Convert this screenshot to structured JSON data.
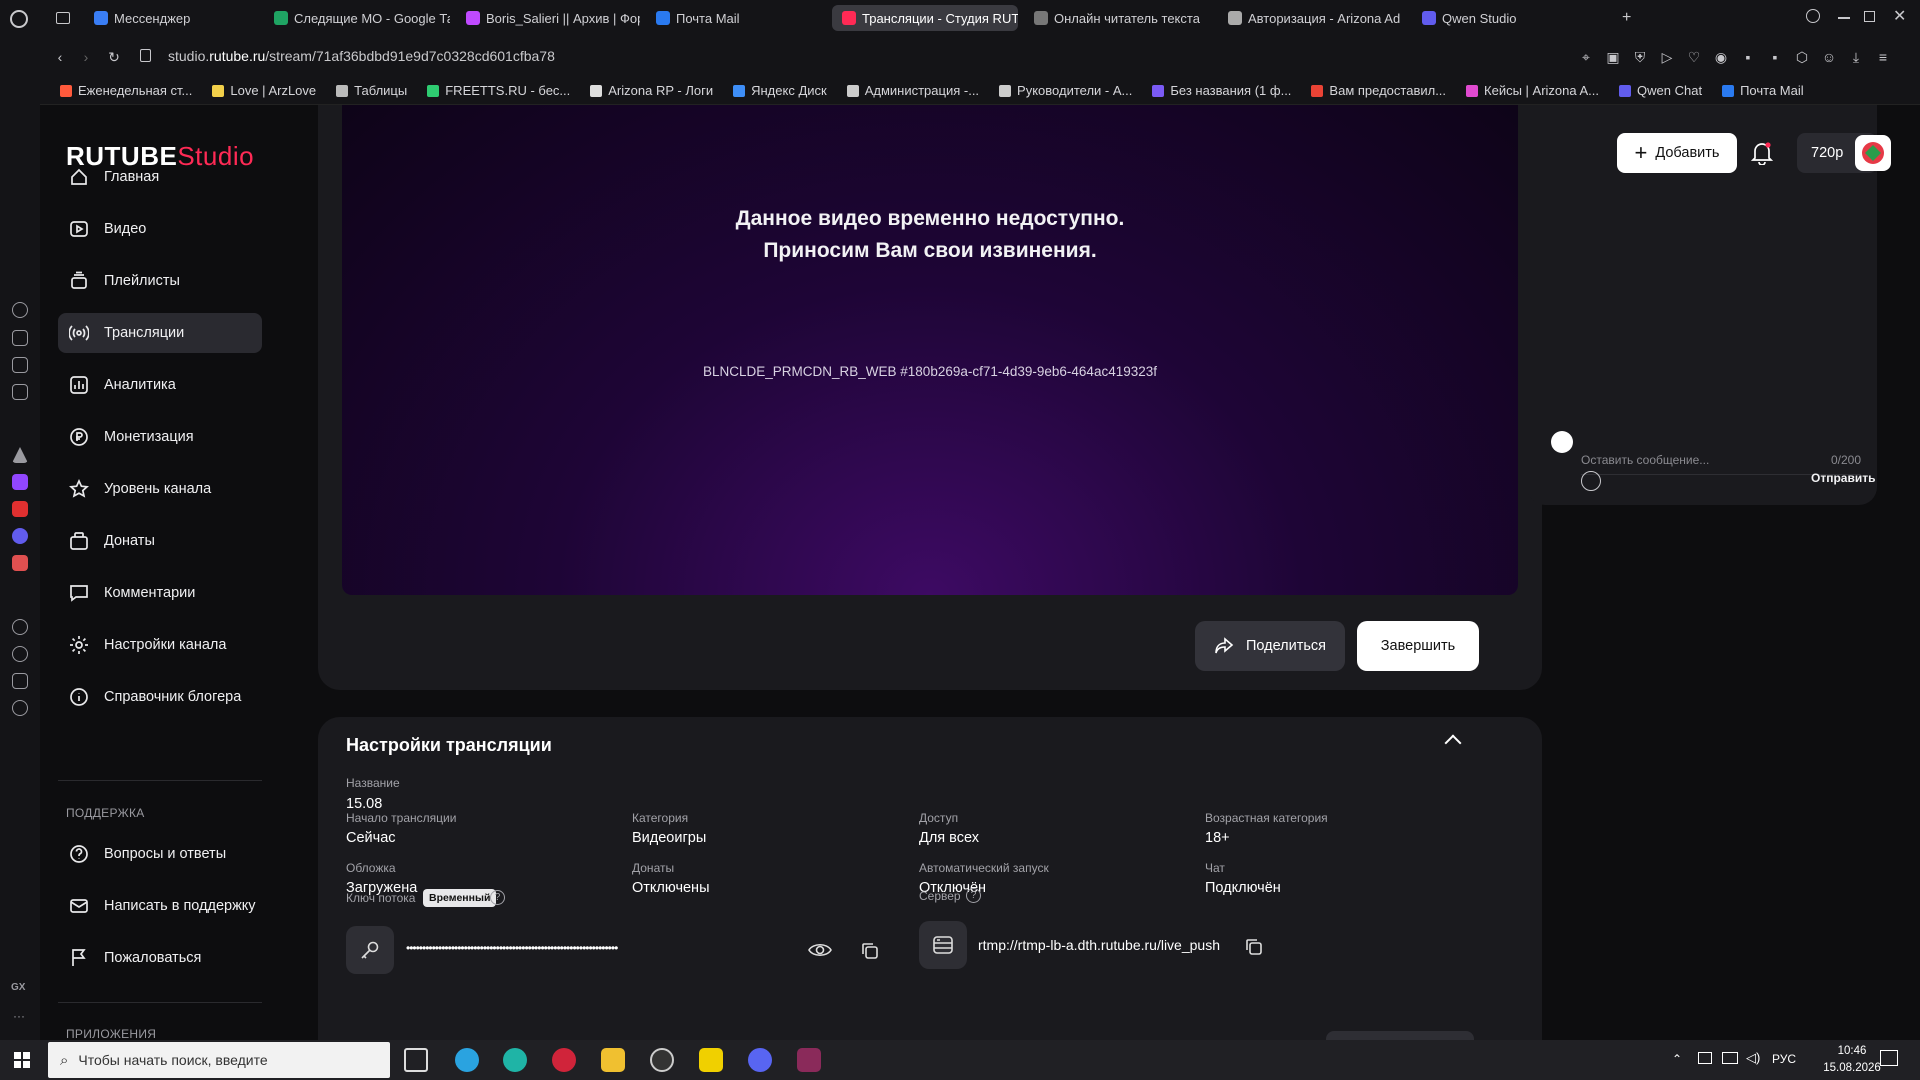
{
  "browser": {
    "tabs": [
      {
        "label": "Мессенджер",
        "color": "#3a7ef5",
        "active": false
      },
      {
        "label": "Следящие МО - Google Та",
        "color": "#1fa463",
        "active": false
      },
      {
        "label": "Boris_Salieri || Архив | Фор",
        "color": "#c04aff",
        "active": false
      },
      {
        "label": "Почта Mail",
        "color": "#2a7af0",
        "active": false
      },
      {
        "label": "Трансляции - Студия RUT",
        "color": "#ff2a55",
        "active": true
      },
      {
        "label": "Онлайн читатель текста",
        "color": "#777",
        "active": false
      },
      {
        "label": "Авторизация - Arizona Ad",
        "color": "#aaa",
        "active": false
      },
      {
        "label": "Qwen Studio",
        "color": "#615ced",
        "active": false
      }
    ],
    "url_prefix": "studio.",
    "url_domain": "rutube.ru",
    "url_path": "/stream/71af36bdbd91e9d7c0328cd601cfba78",
    "bookmarks": [
      {
        "label": "Еженедельная ст...",
        "color": "#ff5a3c"
      },
      {
        "label": "Love | ArzLove",
        "color": "#f2d04a"
      },
      {
        "label": "Таблицы",
        "color": "#bbb"
      },
      {
        "label": "FREETTS.RU - бес...",
        "color": "#2ecc71"
      },
      {
        "label": "Arizona RP - Логи",
        "color": "#ddd"
      },
      {
        "label": "Яндекс Диск",
        "color": "#3e8ef7"
      },
      {
        "label": "Администрация -...",
        "color": "#ccc"
      },
      {
        "label": "Руководители - А...",
        "color": "#ccc"
      },
      {
        "label": "Без названия (1 ф...",
        "color": "#7a5af5"
      },
      {
        "label": "Вам предоставил...",
        "color": "#ea4335"
      },
      {
        "label": "Кейсы | Arizona A...",
        "color": "#e04ad0"
      },
      {
        "label": "Qwen Chat",
        "color": "#615ced"
      },
      {
        "label": "Почта Mail",
        "color": "#2a7af0"
      }
    ]
  },
  "header": {
    "logo_main": "RUTUBE",
    "logo_accent": "Studio",
    "add_label": "Добавить",
    "quality": "720p"
  },
  "sidebar": {
    "items": [
      {
        "label": "Главная",
        "icon": "home"
      },
      {
        "label": "Видео",
        "icon": "video"
      },
      {
        "label": "Плейлисты",
        "icon": "playlist"
      },
      {
        "label": "Трансляции",
        "icon": "broadcast"
      },
      {
        "label": "Аналитика",
        "icon": "analytics"
      },
      {
        "label": "Монетизация",
        "icon": "coin"
      },
      {
        "label": "Уровень канала",
        "icon": "star"
      },
      {
        "label": "Донаты",
        "icon": "gift"
      },
      {
        "label": "Комментарии",
        "icon": "comment"
      },
      {
        "label": "Настройки канала",
        "icon": "gear"
      },
      {
        "label": "Справочник блогера",
        "icon": "info"
      }
    ],
    "support_title": "ПОДДЕРЖКА",
    "support_items": [
      {
        "label": "Вопросы и ответы",
        "icon": "question"
      },
      {
        "label": "Написать в поддержку",
        "icon": "mail"
      },
      {
        "label": "Пожаловаться",
        "icon": "flag"
      }
    ],
    "apps_title": "ПРИЛОЖЕНИЯ"
  },
  "player": {
    "message_line1": "Данное видео временно недоступно.",
    "message_line2": "Приносим Вам свои извинения.",
    "error_code": "BLNCLDE_PRMCDN_RB_WEB #180b269a-cf71-4d39-9eb6-464ac419323f",
    "share_label": "Поделиться",
    "finish_label": "Завершить"
  },
  "chat": {
    "placeholder": "Оставить сообщение...",
    "counter": "0/200",
    "send_label": "Отправить"
  },
  "settings": {
    "title": "Настройки трансляции",
    "name_label": "Название",
    "name_value": "15.08",
    "fields": [
      {
        "label": "Начало трансляции",
        "value": "Сейчас"
      },
      {
        "label": "Категория",
        "value": "Видеоигры"
      },
      {
        "label": "Доступ",
        "value": "Для всех"
      },
      {
        "label": "Возрастная категория",
        "value": "18+"
      },
      {
        "label": "Обложка",
        "value": "Загружена"
      },
      {
        "label": "Донаты",
        "value": "Отключены"
      },
      {
        "label": "Автоматический запуск",
        "value": "Отключён"
      },
      {
        "label": "Чат",
        "value": "Подключён"
      }
    ],
    "stream_key_label": "Ключ потока",
    "stream_key_badge": "Временный",
    "stream_key_masked": "••••••••••••••••••••••••••••••••••••••••••••••••••••••••••••••••••",
    "server_label": "Сервер",
    "server_value": "rtmp://rtmp-lb-a.dth.rutube.ru/live_push"
  },
  "taskbar": {
    "search_placeholder": "Чтобы начать поиск, введите",
    "lang": "РУС",
    "time": "10:46",
    "date": "15.08.2026"
  },
  "colors": {
    "accent": "#ff2a55",
    "panel": "#1a1a1e",
    "background": "#0d0d0f"
  }
}
